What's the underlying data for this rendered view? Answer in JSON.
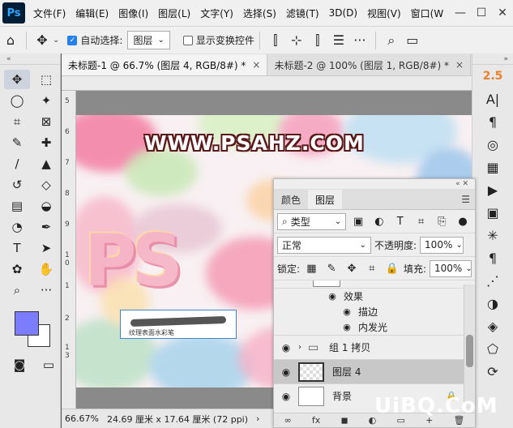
{
  "app": {
    "logo": "Ps"
  },
  "menu": [
    "文件(F)",
    "编辑(E)",
    "图像(I)",
    "图层(L)",
    "文字(Y)",
    "选择(S)",
    "滤镜(T)",
    "3D(D)",
    "视图(V)",
    "窗口(W"
  ],
  "window_controls": [
    "—",
    "☐",
    "✕"
  ],
  "options": {
    "auto_select_label": "自动选择:",
    "auto_select_value": "图层",
    "show_transform_label": "显示变换控件"
  },
  "tabs": [
    {
      "label": "未标题-1 @ 66.7% (图层 4, RGB/8#) *",
      "close": "×"
    },
    {
      "label": "未标题-2 @ 100% (图层 1, RGB/8#) *",
      "close": "×"
    }
  ],
  "ruler_left": [
    "5",
    "6",
    "7",
    "8",
    "9",
    "1",
    "0",
    "1",
    "2",
    "1",
    "3"
  ],
  "canvas": {
    "watermark": "WWW.PSAHZ.COM",
    "big_text": "PS",
    "brush_label": "纹理表面水彩笔"
  },
  "status": {
    "zoom": "66.67%",
    "size": "24.69 厘米 x 17.64 厘米 (72 ppi)"
  },
  "rightbar": {
    "first": "2.5",
    "second": "A|"
  },
  "layers_panel": {
    "tabs": [
      "颜色",
      "图层"
    ],
    "filter_label": "类型",
    "blend_mode": "正常",
    "opacity_label": "不透明度:",
    "opacity_value": "100%",
    "lock_label": "锁定:",
    "fill_label": "填充:",
    "fill_value": "100%",
    "effects_label": "效果",
    "effect_1": "描边",
    "effect_2": "内发光",
    "group_name": "组 1 拷贝",
    "layer_4": "图层 4",
    "background": "背景",
    "bottom_icons": [
      "∞",
      "fx",
      "◼",
      "◐",
      "▭",
      "+",
      "🗑"
    ]
  },
  "brandmark": "UiBQ.CoM",
  "colors": {
    "foreground": "#7b7dfd",
    "background": "#ffffff",
    "accent": "#e8822a"
  }
}
